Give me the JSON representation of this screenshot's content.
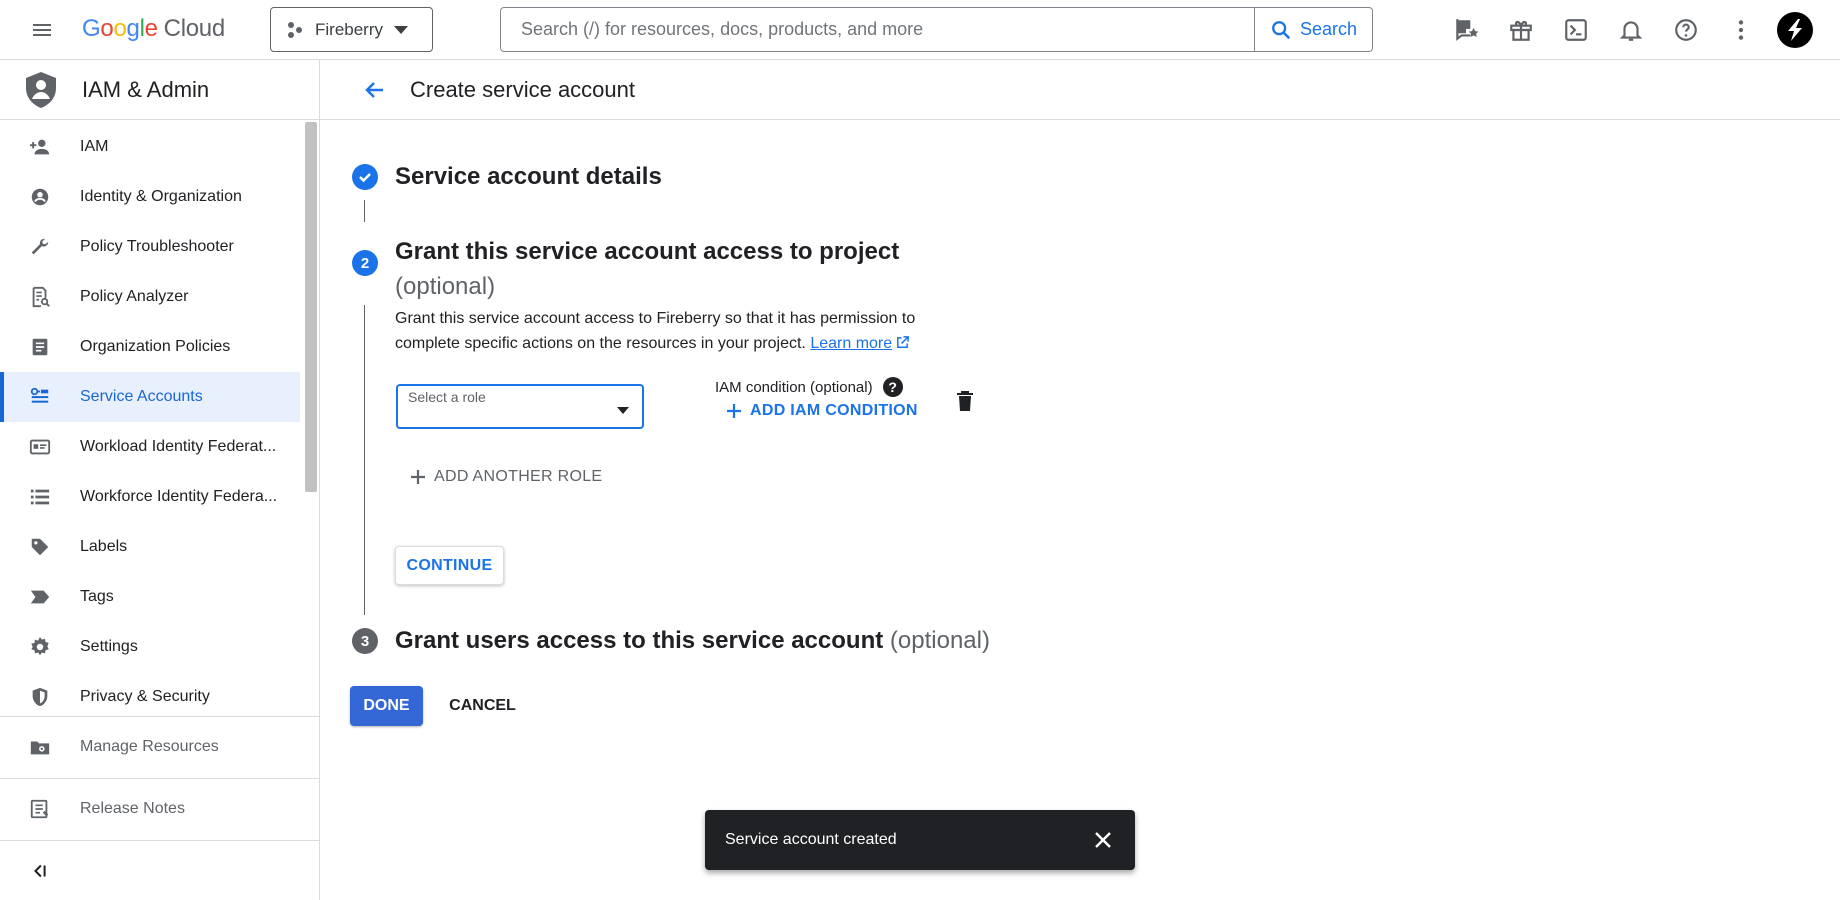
{
  "topbar": {
    "logo_letters": [
      "G",
      "o",
      "o",
      "g",
      "l",
      "e"
    ],
    "logo_suffix": "Cloud",
    "project_name": "Fireberry",
    "search_placeholder": "Search (/) for resources, docs, products, and more",
    "search_button": "Search",
    "icons": [
      "feedback-icon",
      "gift-icon",
      "cloud-shell-icon",
      "notifications-icon",
      "help-icon",
      "more-vert-icon"
    ]
  },
  "sidebar": {
    "title": "IAM & Admin",
    "items": [
      {
        "label": "IAM",
        "icon": "person-add-icon",
        "active": false
      },
      {
        "label": "Identity & Organization",
        "icon": "account-circle-icon",
        "active": false
      },
      {
        "label": "Policy Troubleshooter",
        "icon": "wrench-icon",
        "active": false
      },
      {
        "label": "Policy Analyzer",
        "icon": "policy-analyzer-icon",
        "active": false
      },
      {
        "label": "Organization Policies",
        "icon": "document-icon",
        "active": false
      },
      {
        "label": "Service Accounts",
        "icon": "service-account-icon",
        "active": true
      },
      {
        "label": "Workload Identity Federat...",
        "icon": "id-card-icon",
        "active": false
      },
      {
        "label": "Workforce Identity Federa...",
        "icon": "list-icon",
        "active": false
      },
      {
        "label": "Labels",
        "icon": "label-icon",
        "active": false
      },
      {
        "label": "Tags",
        "icon": "tag-icon",
        "active": false
      },
      {
        "label": "Settings",
        "icon": "gear-icon",
        "active": false
      },
      {
        "label": "Privacy & Security",
        "icon": "shield-icon",
        "active": false
      }
    ],
    "manage_resources": "Manage Resources",
    "release_notes": "Release Notes"
  },
  "header": {
    "title": "Create service account"
  },
  "steps": {
    "step1_title": "Service account details",
    "step2_number": "2",
    "step2_title": "Grant this service account access to project",
    "step2_optional": "(optional)",
    "step2_desc": "Grant this service account access to Fireberry so that it has permission to complete specific actions on the resources in your project.",
    "learn_more": "Learn more",
    "role_label": "Select a role",
    "iam_condition_label": "IAM condition (optional)",
    "add_iam_condition": "ADD IAM CONDITION",
    "add_another_role": "ADD ANOTHER ROLE",
    "continue": "CONTINUE",
    "step3_number": "3",
    "step3_title": "Grant users access to this service account",
    "step3_optional": "(optional)"
  },
  "actions": {
    "done": "DONE",
    "cancel": "CANCEL"
  },
  "snackbar": {
    "message": "Service account created"
  },
  "colors": {
    "accent": "#1a73e8",
    "done_bg": "#3367d6",
    "active_bg": "#e8f0fe"
  }
}
